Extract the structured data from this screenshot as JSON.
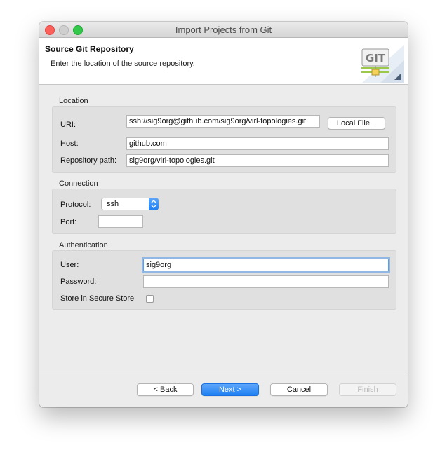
{
  "window": {
    "title": "Import Projects from Git"
  },
  "header": {
    "title": "Source Git Repository",
    "description": "Enter the location of the source repository.",
    "logo_text": "GIT"
  },
  "location": {
    "section": "Location",
    "uri_label": "URI:",
    "uri_value": "ssh://sig9org@github.com/sig9org/virl-topologies.git",
    "local_file_button": "Local File...",
    "host_label": "Host:",
    "host_value": "github.com",
    "repo_path_label": "Repository path:",
    "repo_path_value": "sig9org/virl-topologies.git"
  },
  "connection": {
    "section": "Connection",
    "protocol_label": "Protocol:",
    "protocol_value": "ssh",
    "port_label": "Port:",
    "port_value": ""
  },
  "authentication": {
    "section": "Authentication",
    "user_label": "User:",
    "user_value": "sig9org",
    "password_label": "Password:",
    "password_value": "",
    "store_label": "Store in Secure Store",
    "store_checked": false
  },
  "buttons": {
    "back": "< Back",
    "next": "Next >",
    "cancel": "Cancel",
    "finish": "Finish"
  },
  "icons": {
    "close": "close-icon",
    "minimize": "minimize-icon",
    "zoom": "zoom-icon",
    "git_logo": "git-logo-icon",
    "dropdown": "chevron-updown-icon"
  }
}
